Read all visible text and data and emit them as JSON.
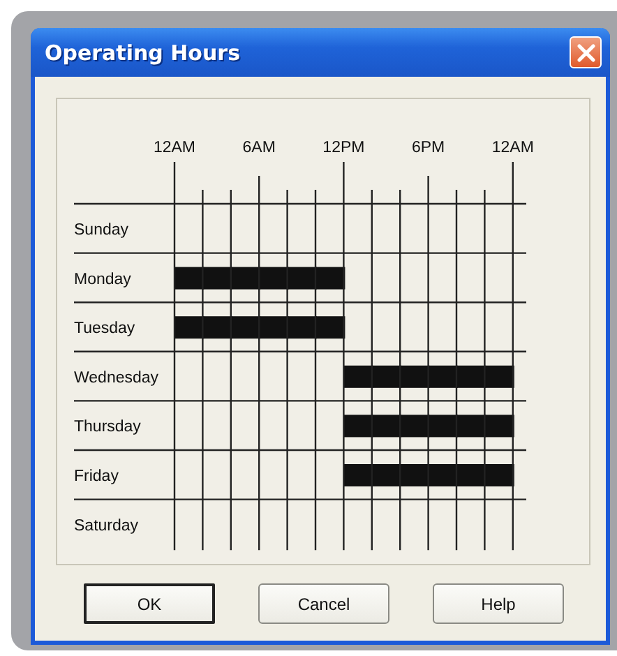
{
  "window": {
    "title": "Operating Hours"
  },
  "time_labels": [
    "12AM",
    "6AM",
    "12PM",
    "6PM",
    "12AM"
  ],
  "days": [
    {
      "name": "Sunday",
      "slots": [
        false,
        false,
        false,
        false,
        false,
        false,
        false,
        false,
        false,
        false,
        false,
        false
      ]
    },
    {
      "name": "Monday",
      "slots": [
        true,
        true,
        true,
        true,
        true,
        true,
        false,
        false,
        false,
        false,
        false,
        false
      ]
    },
    {
      "name": "Tuesday",
      "slots": [
        true,
        true,
        true,
        true,
        true,
        true,
        false,
        false,
        false,
        false,
        false,
        false
      ]
    },
    {
      "name": "Wednesday",
      "slots": [
        false,
        false,
        false,
        false,
        false,
        false,
        true,
        true,
        true,
        true,
        true,
        true
      ]
    },
    {
      "name": "Thursday",
      "slots": [
        false,
        false,
        false,
        false,
        false,
        false,
        true,
        true,
        true,
        true,
        true,
        true
      ]
    },
    {
      "name": "Friday",
      "slots": [
        false,
        false,
        false,
        false,
        false,
        false,
        true,
        true,
        true,
        true,
        true,
        true
      ]
    },
    {
      "name": "Saturday",
      "slots": [
        false,
        false,
        false,
        false,
        false,
        false,
        false,
        false,
        false,
        false,
        false,
        false
      ]
    }
  ],
  "buttons": [
    {
      "label": "OK",
      "default": true
    },
    {
      "label": "Cancel",
      "default": false
    },
    {
      "label": "Help",
      "default": false
    }
  ]
}
